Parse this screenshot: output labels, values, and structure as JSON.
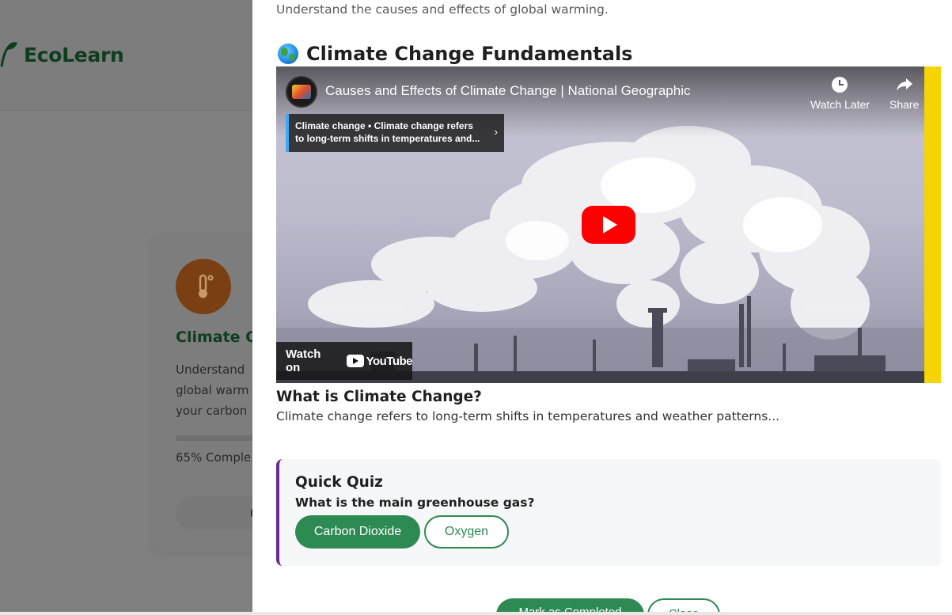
{
  "app": {
    "logo_text": "EcoLearn"
  },
  "background_card": {
    "icon": "thermometer-icon",
    "title": "Climate Cl",
    "description_lines": [
      "Understand",
      "global warm",
      "your carbon"
    ],
    "progress_text": "65% Comple",
    "progress": 0.65
  },
  "modal": {
    "subtitle": "Understand the causes and effects of global warming.",
    "section_icon": "globe-icon",
    "section_title": "Climate Change Fundamentals",
    "video": {
      "title": "Causes and Effects of Climate Change | National Geographic",
      "watch_later": "Watch Later",
      "share": "Share",
      "info_card": "Climate change • Climate change refers to long-term shifts in temperatures and...",
      "watch_on": "Watch on",
      "youtube": "YouTube"
    },
    "lesson_heading": "What is Climate Change?",
    "lesson_text": "Climate change refers to long-term shifts in temperatures and weather patterns...",
    "quiz": {
      "title": "Quick Quiz",
      "question": "What is the main greenhouse gas?",
      "options": [
        "Carbon Dioxide",
        "Oxygen"
      ]
    },
    "footer": {
      "complete_label": "Mark as Completed",
      "close_label": "Close"
    }
  },
  "colors": {
    "primary_green": "#2d8a52",
    "quiz_accent": "#6a2c8f",
    "video_accent": "#f5d400",
    "play_red": "#ff0000"
  }
}
